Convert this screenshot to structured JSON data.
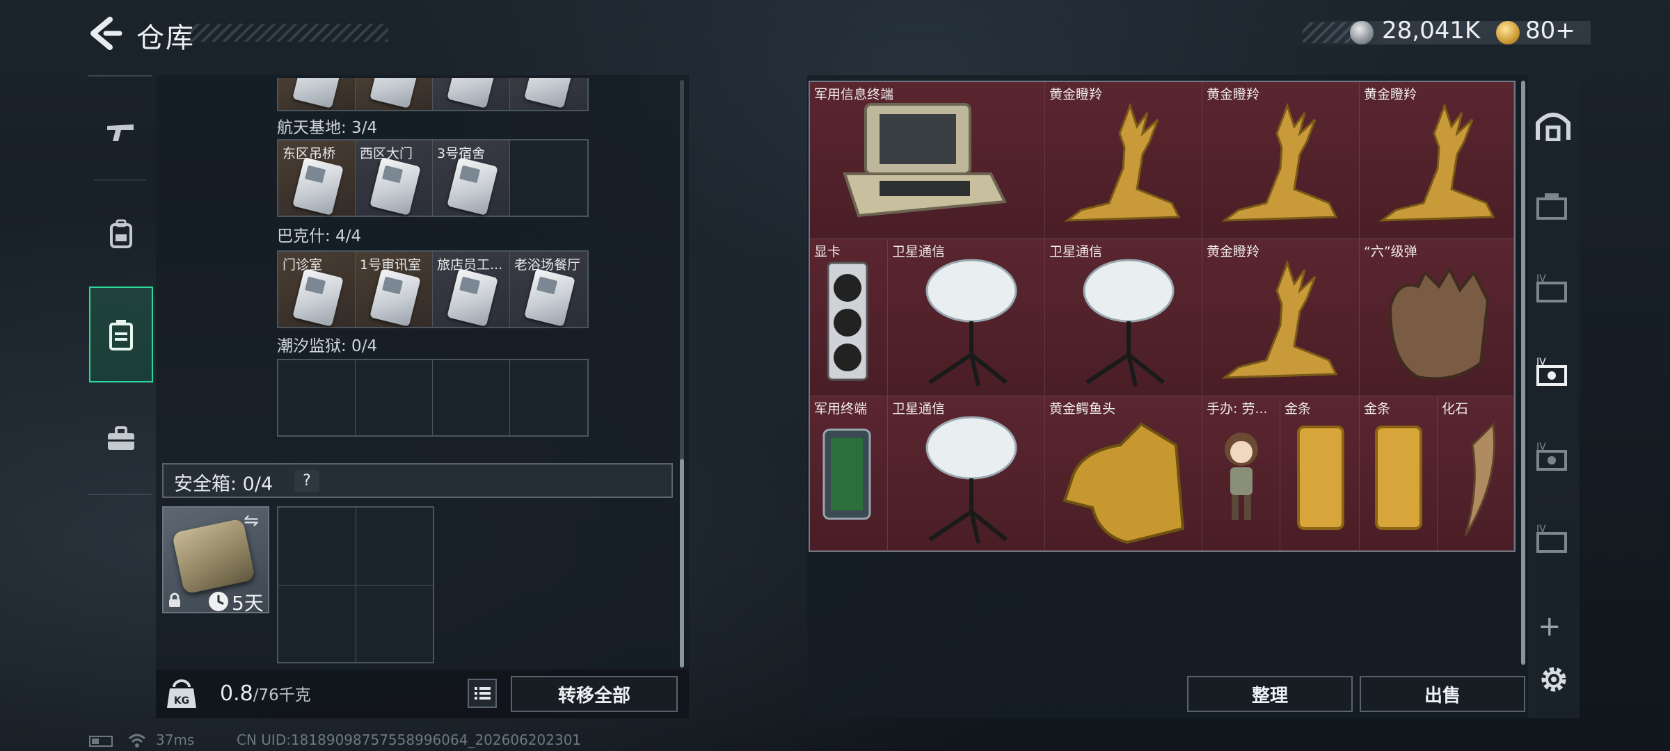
{
  "header": {
    "title": "仓库"
  },
  "currency": {
    "silver_value": "28,041K",
    "gold_value": "80+"
  },
  "left_nav": {
    "items": [
      "gun-icon",
      "backpack-icon",
      "container-icon",
      "toolbox-icon"
    ],
    "active": "container-icon"
  },
  "card_sets": [
    {
      "label": "航天基地: 3/4",
      "slots": [
        "东区吊桥",
        "西区大门",
        "3号宿舍",
        ""
      ]
    },
    {
      "label": "巴克什: 4/4",
      "slots": [
        "门诊室",
        "1号审讯室",
        "旅店员工...",
        "老浴场餐厅"
      ]
    },
    {
      "label": "潮汐监狱: 0/4",
      "slots": [
        "",
        "",
        "",
        ""
      ]
    }
  ],
  "safe_box": {
    "label": "安全箱: 0/4",
    "help": "?",
    "timer": "5天"
  },
  "weight": {
    "current": "0.8",
    "max": "/76千克"
  },
  "buttons": {
    "transfer_all": "转移全部",
    "sort": "整理",
    "sell": "出售"
  },
  "stash_items": [
    {
      "name": "军用信息终端"
    },
    {
      "name": "黄金瞪羚"
    },
    {
      "name": "黄金瞪羚"
    },
    {
      "name": "黄金瞪羚"
    },
    {
      "name": "显卡"
    },
    {
      "name": "卫星通信"
    },
    {
      "name": "卫星通信"
    },
    {
      "name": "黄金瞪羚"
    },
    {
      "name": "“六”级弹"
    },
    {
      "name": "军用终端"
    },
    {
      "name": "卫星通信"
    },
    {
      "name": "黄金鳄鱼头"
    },
    {
      "name": "手办: 劳..."
    },
    {
      "name": "金条"
    },
    {
      "name": "金条"
    },
    {
      "name": "化石"
    }
  ],
  "status": {
    "ping": "37ms",
    "uid": "CN UID:18189098757558996064_202606202301"
  },
  "colors": {
    "accent": "#2fd79b",
    "stash_bg": "#4a1f26",
    "gold": "#c8952f"
  }
}
